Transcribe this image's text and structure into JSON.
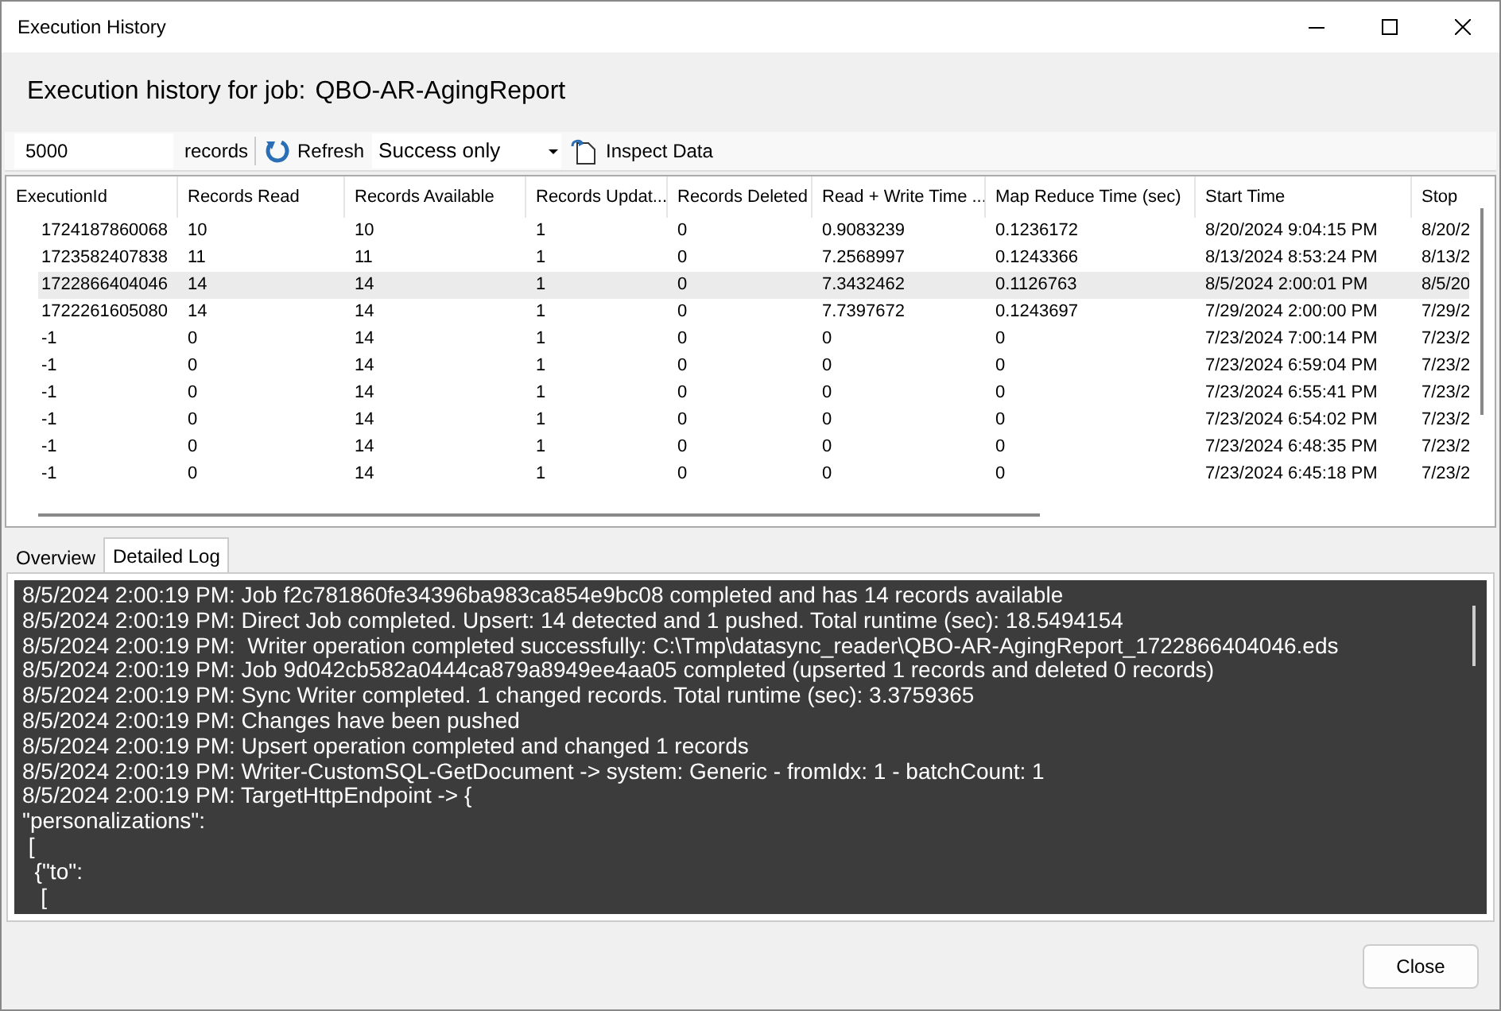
{
  "window": {
    "title": "Execution History"
  },
  "heading": {
    "label": "Execution history for job:",
    "job": "QBO-AR-AgingReport"
  },
  "toolbar": {
    "limit_value": "5000",
    "limit_unit": "records",
    "refresh": "Refresh",
    "filter": "Success only",
    "inspect": "Inspect Data"
  },
  "table": {
    "columns": [
      "ExecutionId",
      "Records Read",
      "Records Available",
      "Records Updat...",
      "Records Deleted",
      "Read + Write Time ...",
      "Map Reduce Time (sec)",
      "Start Time",
      "Stop"
    ],
    "rows": [
      {
        "selected": false,
        "cells": [
          "1724187860068",
          "10",
          "10",
          "1",
          "0",
          "0.9083239",
          "0.1236172",
          "8/20/2024 9:04:15 PM",
          "8/20/2"
        ]
      },
      {
        "selected": false,
        "cells": [
          "1723582407838",
          "11",
          "11",
          "1",
          "0",
          "7.2568997",
          "0.1243366",
          "8/13/2024 8:53:24 PM",
          "8/13/2"
        ]
      },
      {
        "selected": true,
        "cells": [
          "1722866404046",
          "14",
          "14",
          "1",
          "0",
          "7.3432462",
          "0.1126763",
          "8/5/2024 2:00:01 PM",
          "8/5/20"
        ]
      },
      {
        "selected": false,
        "cells": [
          "1722261605080",
          "14",
          "14",
          "1",
          "0",
          "7.7397672",
          "0.1243697",
          "7/29/2024 2:00:00 PM",
          "7/29/2"
        ]
      },
      {
        "selected": false,
        "cells": [
          "-1",
          "0",
          "14",
          "1",
          "0",
          "0",
          "0",
          "7/23/2024 7:00:14 PM",
          "7/23/2"
        ]
      },
      {
        "selected": false,
        "cells": [
          "-1",
          "0",
          "14",
          "1",
          "0",
          "0",
          "0",
          "7/23/2024 6:59:04 PM",
          "7/23/2"
        ]
      },
      {
        "selected": false,
        "cells": [
          "-1",
          "0",
          "14",
          "1",
          "0",
          "0",
          "0",
          "7/23/2024 6:55:41 PM",
          "7/23/2"
        ]
      },
      {
        "selected": false,
        "cells": [
          "-1",
          "0",
          "14",
          "1",
          "0",
          "0",
          "0",
          "7/23/2024 6:54:02 PM",
          "7/23/2"
        ]
      },
      {
        "selected": false,
        "cells": [
          "-1",
          "0",
          "14",
          "1",
          "0",
          "0",
          "0",
          "7/23/2024 6:48:35 PM",
          "7/23/2"
        ]
      },
      {
        "selected": false,
        "cells": [
          "-1",
          "0",
          "14",
          "1",
          "0",
          "0",
          "0",
          "7/23/2024 6:45:18 PM",
          "7/23/2"
        ]
      }
    ]
  },
  "tabs": [
    {
      "label": "Overview",
      "selected": false
    },
    {
      "label": "Detailed Log",
      "selected": true
    }
  ],
  "log": [
    "8/5/2024 2:00:19 PM: Job f2c781860fe34396ba983ca854e9bc08 completed and has 14 records available",
    "8/5/2024 2:00:19 PM: Direct Job completed. Upsert: 14 detected and 1 pushed. Total runtime (sec): 18.5494154",
    "8/5/2024 2:00:19 PM:  Writer operation completed successfully: C:\\Tmp\\datasync_reader\\QBO-AR-AgingReport_1722866404046.eds",
    "8/5/2024 2:00:19 PM: Job 9d042cb582a0444ca879a8949ee4aa05 completed (upserted 1 records and deleted 0 records)",
    "8/5/2024 2:00:19 PM: Sync Writer completed. 1 changed records. Total runtime (sec): 3.3759365",
    "8/5/2024 2:00:19 PM: Changes have been pushed",
    "8/5/2024 2:00:19 PM: Upsert operation completed and changed 1 records",
    "8/5/2024 2:00:19 PM: Writer-CustomSQL-GetDocument -> system: Generic - fromIdx: 1 - batchCount: 1",
    "8/5/2024 2:00:19 PM: TargetHttpEndpoint -> {",
    "\"personalizations\":",
    " [",
    "  {\"to\":",
    "   ["
  ],
  "buttons": {
    "close": "Close"
  }
}
